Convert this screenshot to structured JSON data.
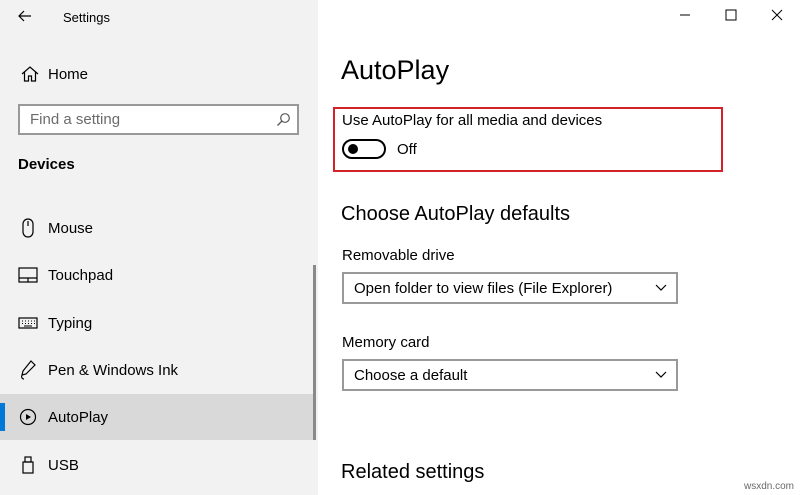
{
  "window": {
    "title": "Settings",
    "controls": [
      "minimize",
      "maximize",
      "close"
    ]
  },
  "sidebar": {
    "home_label": "Home",
    "search_placeholder": "Find a setting",
    "section_heading": "Devices",
    "items": [
      {
        "label": "Mouse",
        "icon": "mouse-icon"
      },
      {
        "label": "Touchpad",
        "icon": "touchpad-icon"
      },
      {
        "label": "Typing",
        "icon": "keyboard-icon"
      },
      {
        "label": "Pen & Windows Ink",
        "icon": "pen-icon"
      },
      {
        "label": "AutoPlay",
        "icon": "autoplay-icon",
        "selected": true
      },
      {
        "label": "USB",
        "icon": "usb-icon"
      }
    ]
  },
  "main": {
    "title": "AutoPlay",
    "autoplay_option": {
      "label": "Use AutoPlay for all media and devices",
      "state": "Off",
      "on": false
    },
    "defaults_heading": "Choose AutoPlay defaults",
    "removable_drive": {
      "label": "Removable drive",
      "value": "Open folder to view files (File Explorer)"
    },
    "memory_card": {
      "label": "Memory card",
      "value": "Choose a default"
    },
    "related_heading": "Related settings"
  },
  "watermark": "wsxdn.com",
  "colors": {
    "accent": "#0078d7",
    "highlight_border": "#d2232a",
    "sidebar_bg": "#f2f2f2",
    "selected_bg": "#d9d9d9"
  }
}
